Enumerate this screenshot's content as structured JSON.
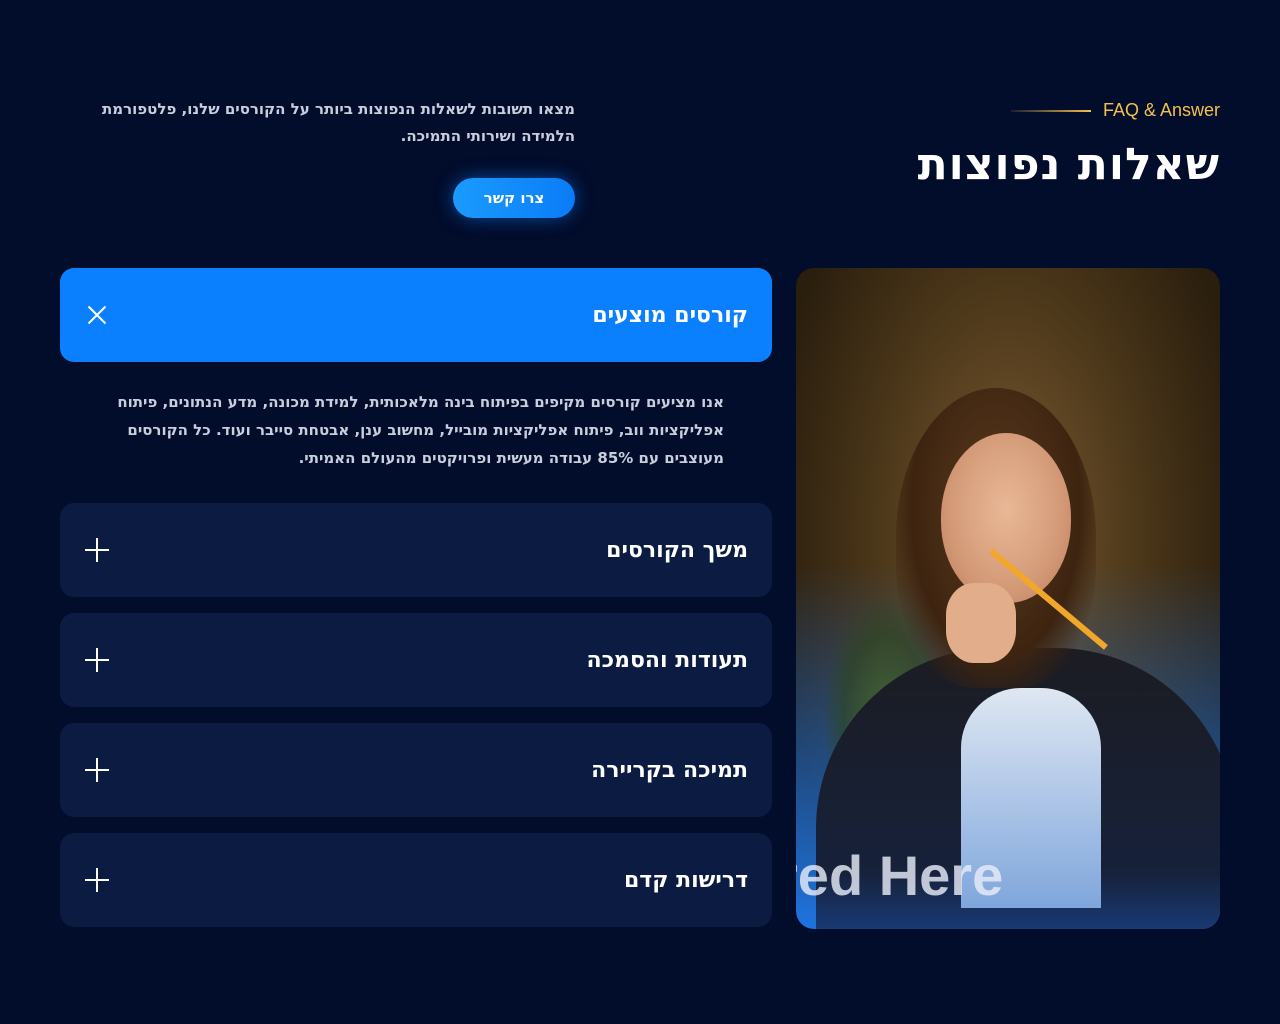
{
  "header": {
    "eyebrow": "FAQ & Answer",
    "title": "שאלות נפוצות",
    "intro": "מצאו תשובות לשאלות הנפוצות ביותר על הקורסים שלנו, פלטפורמת הלמידה ושירותי התמיכה.",
    "contact_button": "צרו קשר"
  },
  "faq": {
    "items": [
      {
        "title": "קורסים מוצעים",
        "open": true
      },
      {
        "title": "משך הקורסים",
        "open": false
      },
      {
        "title": "תעודות והסמכה",
        "open": false
      },
      {
        "title": "תמיכה בקריירה",
        "open": false
      },
      {
        "title": "דרישות קדם",
        "open": false
      }
    ],
    "open_answer": "אנו מציעים קורסים מקיפים בפיתוח בינה מלאכותית, למידת מכונה, מדע הנתונים, פיתוח אפליקציות ווב, פיתוח אפליקציות מובייל, מחשוב ענן, אבטחת סייבר ועוד. כל הקורסים מעוצבים עם 85% עבודה מעשית ופרויקטים מהעולם האמיתי."
  },
  "photo": {
    "overlay_text": "red Here"
  },
  "colors": {
    "background": "#020c2b",
    "accent": "#0a80ff",
    "eyebrow": "#f2c14e",
    "card": "#0b1b42"
  }
}
